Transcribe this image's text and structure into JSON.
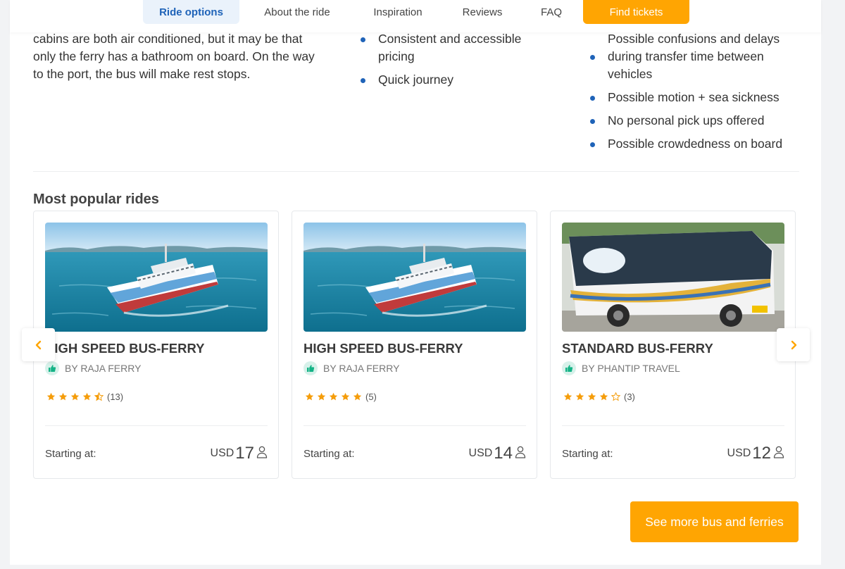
{
  "nav": {
    "tabs": [
      {
        "label": "Ride options"
      },
      {
        "label": "About the ride"
      },
      {
        "label": "Inspiration"
      },
      {
        "label": "Reviews"
      },
      {
        "label": "FAQ"
      }
    ],
    "cta_label": "Find tickets"
  },
  "intro": {
    "lines": [
      "cabins are both air conditioned, but it may be that",
      "only the ferry has a bathroom on board. On the way",
      "to the port, the bus will make rest stops."
    ]
  },
  "pros": [
    "Consistent and accessible pricing",
    "Quick journey"
  ],
  "cons": [
    "Possible confusions and delays during transfer time between vehicles",
    "Possible motion + sea sickness",
    "No personal pick ups offered",
    "Possible crowdedness on board"
  ],
  "section_title": "Most popular rides",
  "cards": [
    {
      "title": "HIGH SPEED BUS-FERRY",
      "operator": "BY RAJA FERRY",
      "rating": 4.5,
      "reviews": "(13)",
      "start_label": "Starting at:",
      "currency": "USD",
      "price": "17",
      "image": "ferry"
    },
    {
      "title": "HIGH SPEED BUS-FERRY",
      "operator": "BY RAJA FERRY",
      "rating": 5,
      "reviews": "(5)",
      "start_label": "Starting at:",
      "currency": "USD",
      "price": "14",
      "image": "ferry"
    },
    {
      "title": "STANDARD BUS-FERRY",
      "operator": "BY PHANTIP TRAVEL",
      "rating": 4,
      "reviews": "(3)",
      "start_label": "Starting at:",
      "currency": "USD",
      "price": "12",
      "image": "bus"
    }
  ],
  "see_more_label": "See more bus and ferries",
  "colors": {
    "accent": "#ffa502",
    "brand_blue": "#1f63b8",
    "star": "#f59d0b"
  },
  "icons": {
    "prev": "chevron-left-icon",
    "next": "chevron-right-icon",
    "thumb": "thumbs-up-icon",
    "person": "person-icon"
  }
}
